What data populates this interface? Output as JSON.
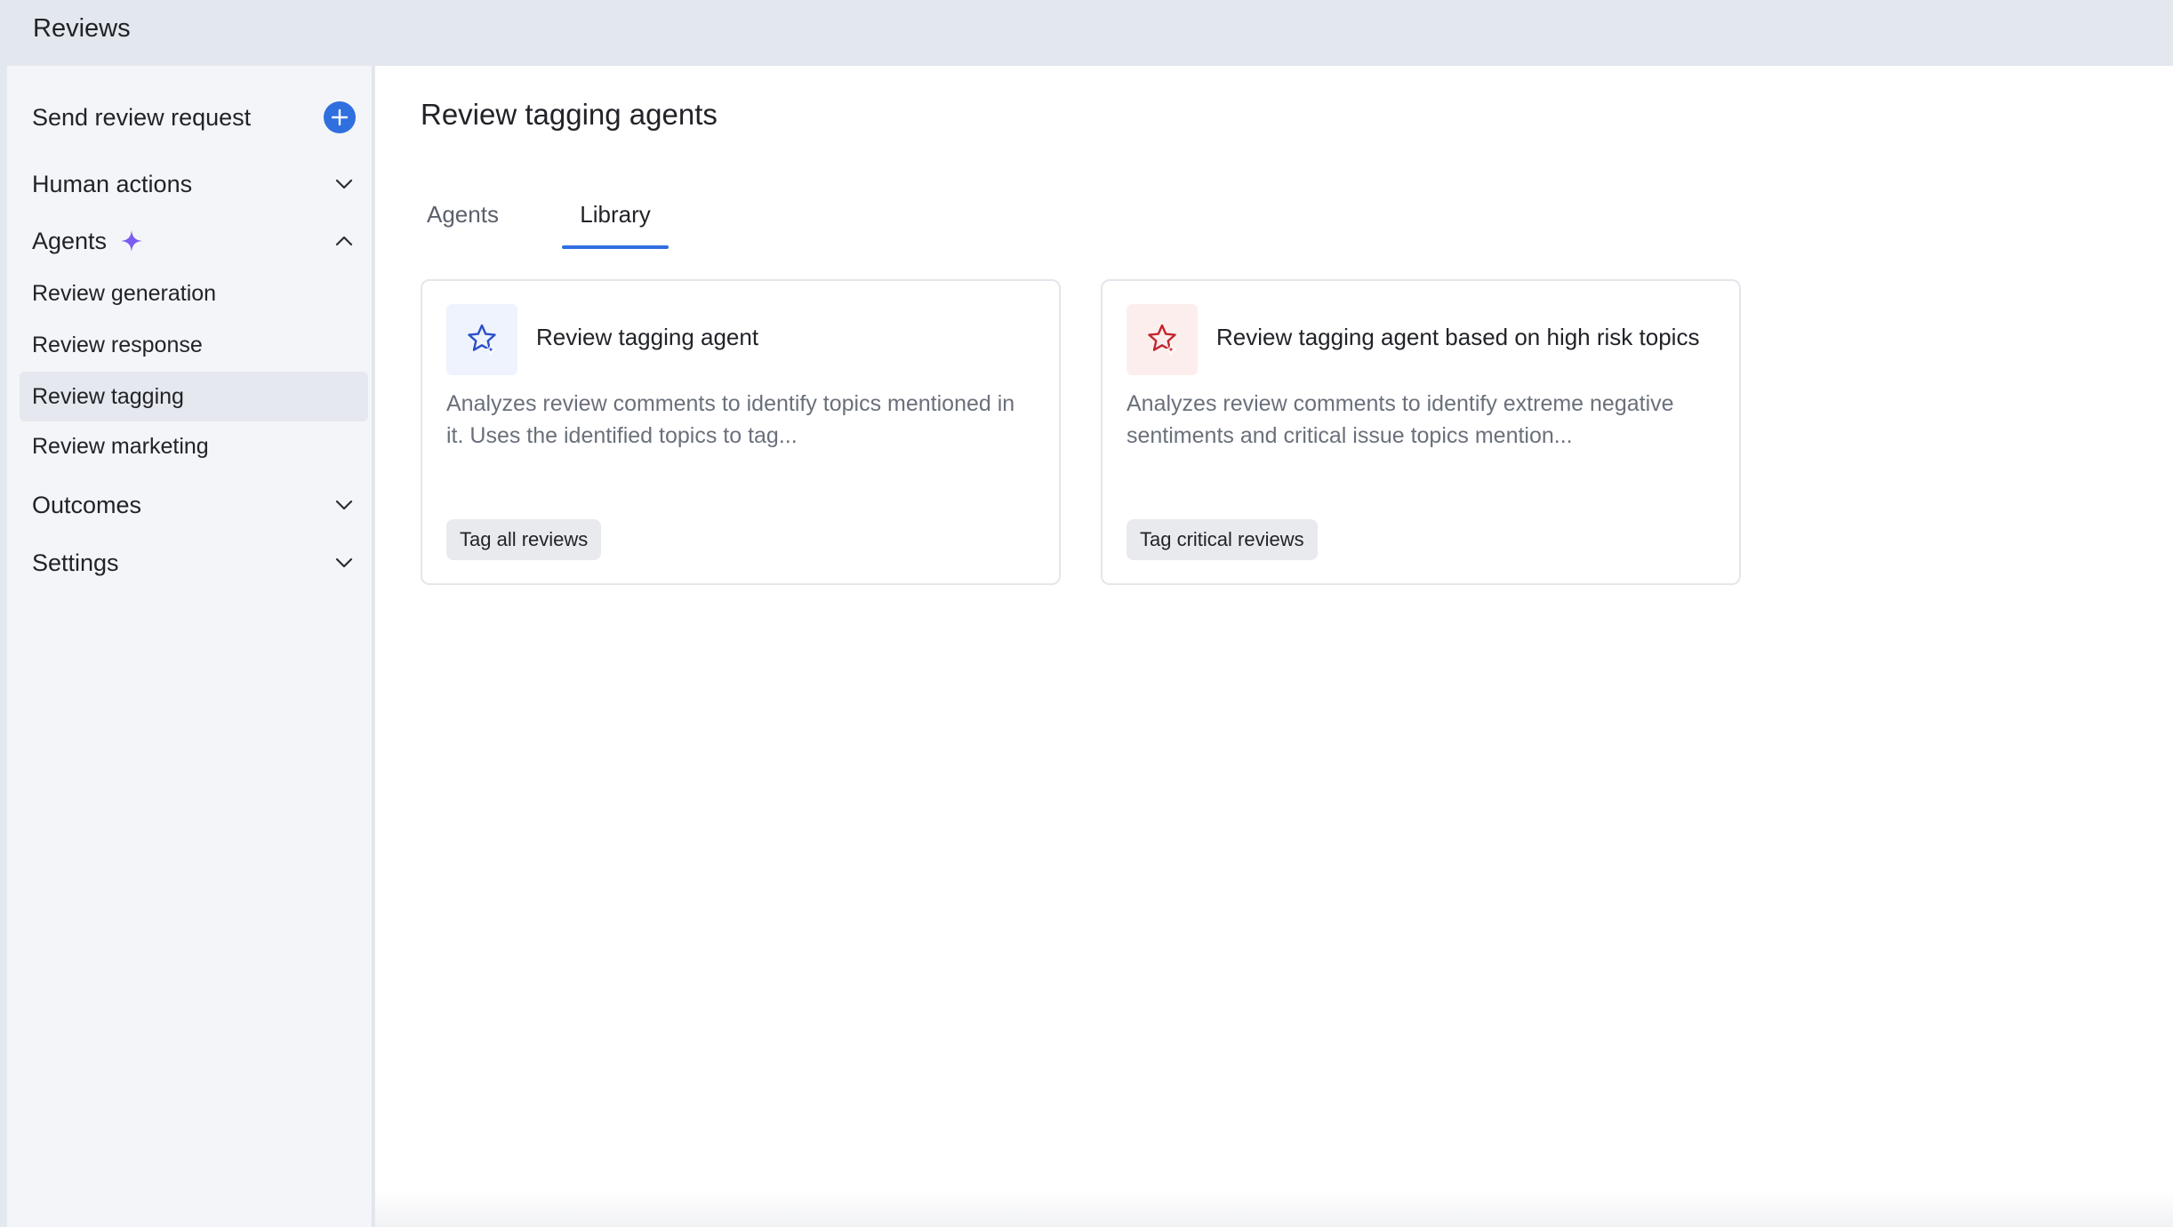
{
  "app": {
    "title": "Reviews"
  },
  "sidebar": {
    "send_request": {
      "label": "Send review request",
      "icon": "plus-icon"
    },
    "human_actions": {
      "label": "Human actions",
      "icon": "chevron-down-icon"
    },
    "agents": {
      "label": "Agents",
      "icon": "chevron-up-icon",
      "badge_icon": "sparkle-icon",
      "items": [
        {
          "label": "Review generation"
        },
        {
          "label": "Review response"
        },
        {
          "label": "Review tagging"
        },
        {
          "label": "Review marketing"
        }
      ],
      "active_item": "Review tagging"
    },
    "outcomes": {
      "label": "Outcomes",
      "icon": "chevron-down-icon"
    },
    "settings": {
      "label": "Settings",
      "icon": "chevron-down-icon"
    }
  },
  "main": {
    "title": "Review tagging agents",
    "tabs": [
      {
        "label": "Agents"
      },
      {
        "label": "Library"
      }
    ],
    "active_tab": "Library",
    "cards": [
      {
        "title": "Review tagging agent",
        "description": "Analyzes review comments to identify topics mentioned in it. Uses the identified topics to tag...",
        "chip": "Tag all reviews",
        "icon": "star-sparkle-icon",
        "accent": "#2b4fc9"
      },
      {
        "title": "Review tagging agent based on high risk topics",
        "description": "Analyzes review comments to identify extreme negative sentiments and critical issue topics mention...",
        "chip": "Tag critical reviews",
        "icon": "star-sparkle-icon",
        "accent": "#c0262d"
      }
    ]
  },
  "colors": {
    "accent": "#2f6fde",
    "sparkle": "#7b5cf0",
    "active_nav_bg": "#e5e8ef"
  }
}
